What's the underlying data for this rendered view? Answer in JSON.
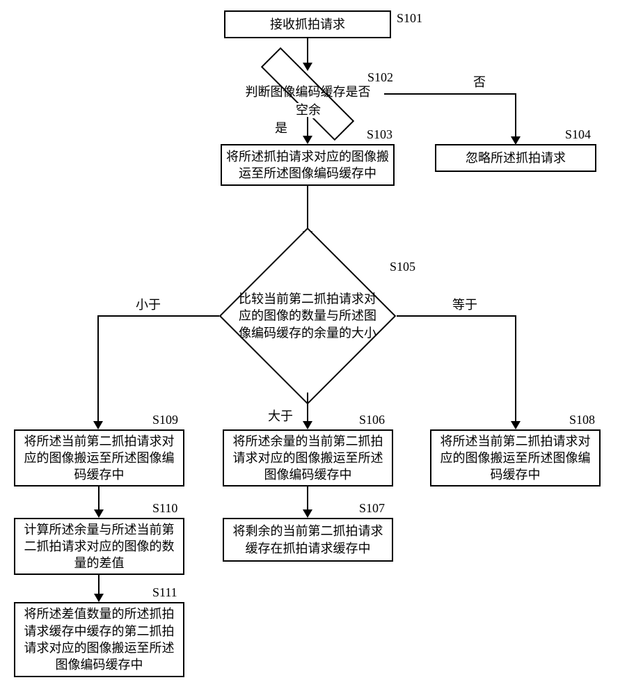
{
  "chart_data": {
    "type": "flowchart",
    "nodes": [
      {
        "id": "S101",
        "label": "S101",
        "text": "接收抓拍请求",
        "shape": "process"
      },
      {
        "id": "S102",
        "label": "S102",
        "text": "判断图像编码缓存是否\n空余",
        "shape": "decision",
        "branches": {
          "yes": "是",
          "no": "否"
        }
      },
      {
        "id": "S103",
        "label": "S103",
        "text": "将所述抓拍请求对应的图像\n搬运至所述图像编码缓存中",
        "shape": "process"
      },
      {
        "id": "S104",
        "label": "S104",
        "text": "忽略所述抓拍请求",
        "shape": "process"
      },
      {
        "id": "S105",
        "label": "S105",
        "text": "比较当前第二抓拍请求\n对应的图像的数量与所\n述图像编码缓存的余量\n的大小",
        "shape": "decision",
        "branches": {
          "lt": "小于",
          "gt": "大于",
          "eq": "等于"
        }
      },
      {
        "id": "S106",
        "label": "S106",
        "text": "将所述余量的当前第二抓拍\n请求对应的图像搬运至所述\n图像编码缓存中",
        "shape": "process"
      },
      {
        "id": "S107",
        "label": "S107",
        "text": "将剩余的当前第二抓拍请求\n缓存在抓拍请求缓存中",
        "shape": "process"
      },
      {
        "id": "S108",
        "label": "S108",
        "text": "将所述当前第二抓拍请求对\n应的图像搬运至所述图像编\n码缓存中",
        "shape": "process"
      },
      {
        "id": "S109",
        "label": "S109",
        "text": "将所述当前第二抓拍请求对\n应的图像搬运至所述图像编\n码缓存中",
        "shape": "process"
      },
      {
        "id": "S110",
        "label": "S110",
        "text": "计算所述余量与所述当前第\n二抓拍请求对应的图像的数\n量的差值",
        "shape": "process"
      },
      {
        "id": "S111",
        "label": "S111",
        "text": "将所述差值数量的所述抓拍\n请求缓存中缓存的第二抓拍\n请求对应的图像搬运至所述\n图像编码缓存中",
        "shape": "process"
      }
    ],
    "edges": [
      {
        "from": "S101",
        "to": "S102"
      },
      {
        "from": "S102",
        "to": "S103",
        "label": "是"
      },
      {
        "from": "S102",
        "to": "S104",
        "label": "否"
      },
      {
        "from": "S103",
        "to": "S105"
      },
      {
        "from": "S105",
        "to": "S109",
        "label": "小于"
      },
      {
        "from": "S105",
        "to": "S106",
        "label": "大于"
      },
      {
        "from": "S105",
        "to": "S108",
        "label": "等于"
      },
      {
        "from": "S106",
        "to": "S107"
      },
      {
        "from": "S109",
        "to": "S110"
      },
      {
        "from": "S110",
        "to": "S111"
      }
    ]
  },
  "nodes": {
    "s101": {
      "label": "S101",
      "text": "接收抓拍请求"
    },
    "s102": {
      "label": "S102",
      "text": "判断图像编码缓存是否",
      "text2": "空余",
      "yes": "是",
      "no": "否"
    },
    "s103": {
      "label": "S103",
      "text": "将所述抓拍请求对应的图像搬运至所述图像编码缓存中"
    },
    "s104": {
      "label": "S104",
      "text": "忽略所述抓拍请求"
    },
    "s105": {
      "label": "S105",
      "text": "比较当前第二抓拍请求对应的图像的数量与所述图像编码缓存的余量的大小",
      "lt": "小于",
      "gt": "大于",
      "eq": "等于"
    },
    "s106": {
      "label": "S106",
      "text": "将所述余量的当前第二抓拍请求对应的图像搬运至所述图像编码缓存中"
    },
    "s107": {
      "label": "S107",
      "text": "将剩余的当前第二抓拍请求缓存在抓拍请求缓存中"
    },
    "s108": {
      "label": "S108",
      "text": "将所述当前第二抓拍请求对应的图像搬运至所述图像编码缓存中"
    },
    "s109": {
      "label": "S109",
      "text": "将所述当前第二抓拍请求对应的图像搬运至所述图像编码缓存中"
    },
    "s110": {
      "label": "S110",
      "text": "计算所述余量与所述当前第二抓拍请求对应的图像的数量的差值"
    },
    "s111": {
      "label": "S111",
      "text": "将所述差值数量的所述抓拍请求缓存中缓存的第二抓拍请求对应的图像搬运至所述图像编码缓存中"
    }
  }
}
